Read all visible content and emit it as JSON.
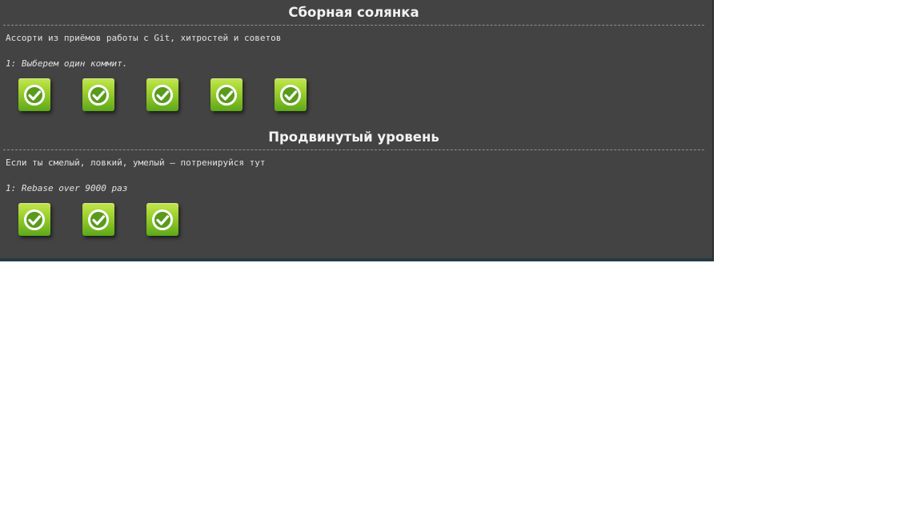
{
  "sections": [
    {
      "title": "Сборная солянка",
      "description": "Ассорти из приёмов работы с Git, хитростей и советов",
      "selected_level": "1: Выберем один коммит.",
      "levels": [
        {
          "completed": true,
          "icon": "checkmark-circle-icon"
        },
        {
          "completed": true,
          "icon": "checkmark-circle-icon"
        },
        {
          "completed": true,
          "icon": "checkmark-circle-icon"
        },
        {
          "completed": true,
          "icon": "checkmark-circle-icon"
        },
        {
          "completed": true,
          "icon": "checkmark-circle-icon"
        }
      ]
    },
    {
      "title": "Продвинутый уровень",
      "description": "Если ты смелый, ловкий, умелый – потренируйся тут",
      "selected_level": "1: Rebase over 9000 раз",
      "levels": [
        {
          "completed": true,
          "icon": "checkmark-circle-icon"
        },
        {
          "completed": true,
          "icon": "checkmark-circle-icon"
        },
        {
          "completed": true,
          "icon": "checkmark-circle-icon"
        }
      ]
    }
  ],
  "colors": {
    "panel_background": "#434343",
    "button_top": "#c3e650",
    "button_bottom": "#5da81a",
    "text": "#e6e6e6"
  }
}
